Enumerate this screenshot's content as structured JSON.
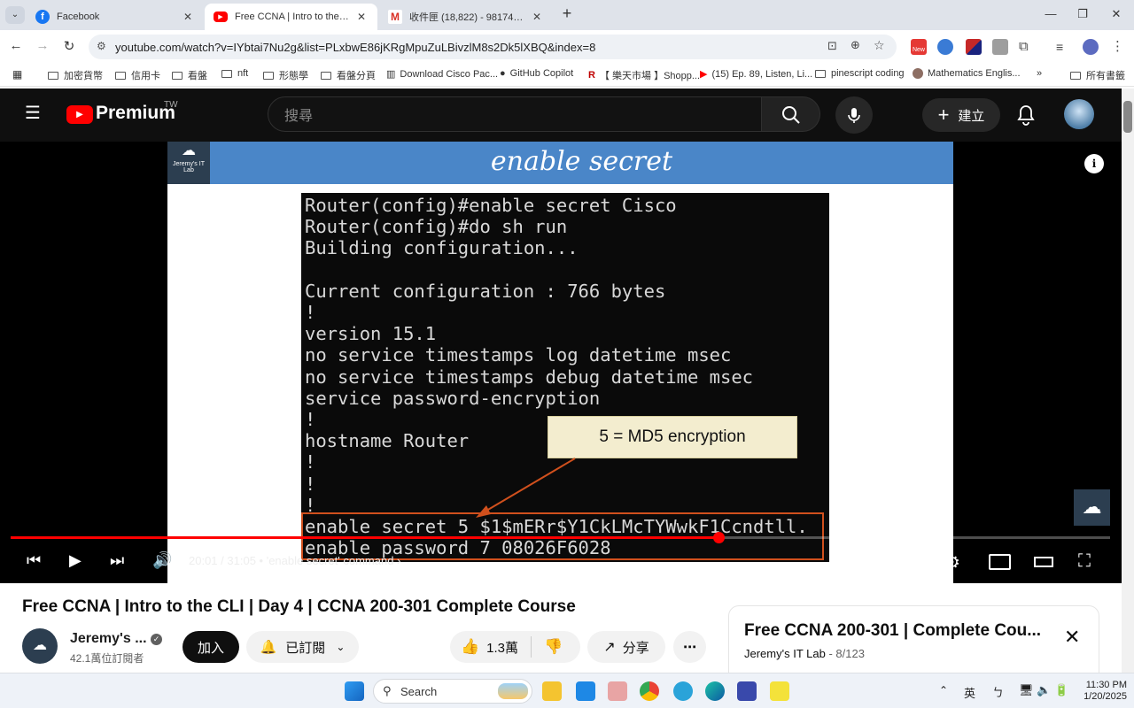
{
  "tabs": [
    {
      "title": "Facebook",
      "favicon": "facebook-icon"
    },
    {
      "title": "Free CCNA | Intro to the CLI | D",
      "favicon": "youtube-icon"
    },
    {
      "title": "收件匣 (18,822) - 981746@gma",
      "favicon": "gmail-icon"
    }
  ],
  "url": "youtube.com/watch?v=IYbtai7Nu2g&list=PLxbwE86jKRgMpuZuLBivzlM8s2Dk5lXBQ&index=8",
  "bookmarks": [
    "加密貨幣",
    "信用卡",
    "看盤",
    "nft",
    "形態學",
    "看盤分頁",
    "Download Cisco Pac...",
    "GitHub Copilot",
    "【 樂天市場 】Shopp...",
    "(15) Ep. 89, Listen, Li...",
    "pinescript coding",
    "Mathematics Englis...",
    "所有書籤"
  ],
  "extensions": {
    "new_badge": "New"
  },
  "yt": {
    "logo": "Premium",
    "region": "TW",
    "search_placeholder": "搜尋",
    "create_label": "建立"
  },
  "video": {
    "slide_title": "enable secret",
    "slide_logo": "Jeremy's IT Lab",
    "terminal_lines": [
      "Router(config)#enable secret Cisco",
      "Router(config)#do sh run",
      "Building configuration...",
      "",
      "Current configuration : 766 bytes",
      "!",
      "version 15.1",
      "no service timestamps log datetime msec",
      "no service timestamps debug datetime msec",
      "service password-encryption",
      "!",
      "hostname Router",
      "!",
      "!",
      "!",
      "enable secret 5 $1$mERr$Y1CkLMcTYWwkF1Ccndtll.",
      "enable password 7 08026F6028"
    ],
    "callout": "5 = MD5 encryption",
    "current_time": "20:01",
    "duration": "31:05",
    "chapter": "'enable secret' command",
    "progress": 0.644
  },
  "page": {
    "title": "Free CCNA | Intro to the CLI | Day 4 | CCNA 200-301 Complete Course",
    "channel_name": "Jeremy's ...",
    "subscribers": "42.1萬位訂閱者",
    "join_label": "加入",
    "subscribed_label": "已訂閱",
    "likes": "1.3萬",
    "share_label": "分享"
  },
  "playlist": {
    "title": "Free CCNA 200-301 | Complete Cou...",
    "channel": "Jeremy's IT Lab",
    "position": "8/123"
  },
  "taskbar": {
    "search_label": "Search",
    "ime": "英",
    "time": "11:30 PM",
    "date": "1/20/2025"
  }
}
